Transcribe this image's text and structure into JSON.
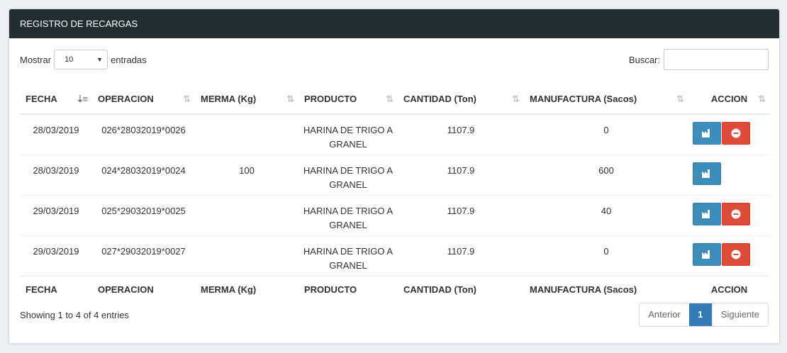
{
  "panel": {
    "title": "REGISTRO DE RECARGAS"
  },
  "length": {
    "prefix": "Mostrar",
    "value": "10",
    "suffix": "entradas"
  },
  "search": {
    "label": "Buscar:",
    "value": ""
  },
  "columns": [
    "FECHA",
    "OPERACION",
    "MERMA (Kg)",
    "PRODUCTO",
    "CANTIDAD (Ton)",
    "MANUFACTURA (Sacos)",
    "ACCION"
  ],
  "rows": [
    {
      "fecha": "28/03/2019",
      "operacion": "026*28032019*0026",
      "merma": "",
      "producto": "HARINA DE TRIGO A GRANEL",
      "cantidad": "1107.9",
      "manufactura": "0",
      "delete": true
    },
    {
      "fecha": "28/03/2019",
      "operacion": "024*28032019*0024",
      "merma": "100",
      "producto": "HARINA DE TRIGO A GRANEL",
      "cantidad": "1107.9",
      "manufactura": "600",
      "delete": false
    },
    {
      "fecha": "29/03/2019",
      "operacion": "025*29032019*0025",
      "merma": "",
      "producto": "HARINA DE TRIGO A GRANEL",
      "cantidad": "1107.9",
      "manufactura": "40",
      "delete": true
    },
    {
      "fecha": "29/03/2019",
      "operacion": "027*29032019*0027",
      "merma": "",
      "producto": "HARINA DE TRIGO A GRANEL",
      "cantidad": "1107.9",
      "manufactura": "0",
      "delete": true
    }
  ],
  "info": "Showing 1 to 4 of 4 entries",
  "pagination": {
    "prev": "Anterior",
    "current": "1",
    "next": "Siguiente"
  },
  "colors": {
    "header_bg": "#222d32",
    "primary": "#3c8dbc",
    "danger": "#dd4b39",
    "page_active": "#337ab7"
  }
}
